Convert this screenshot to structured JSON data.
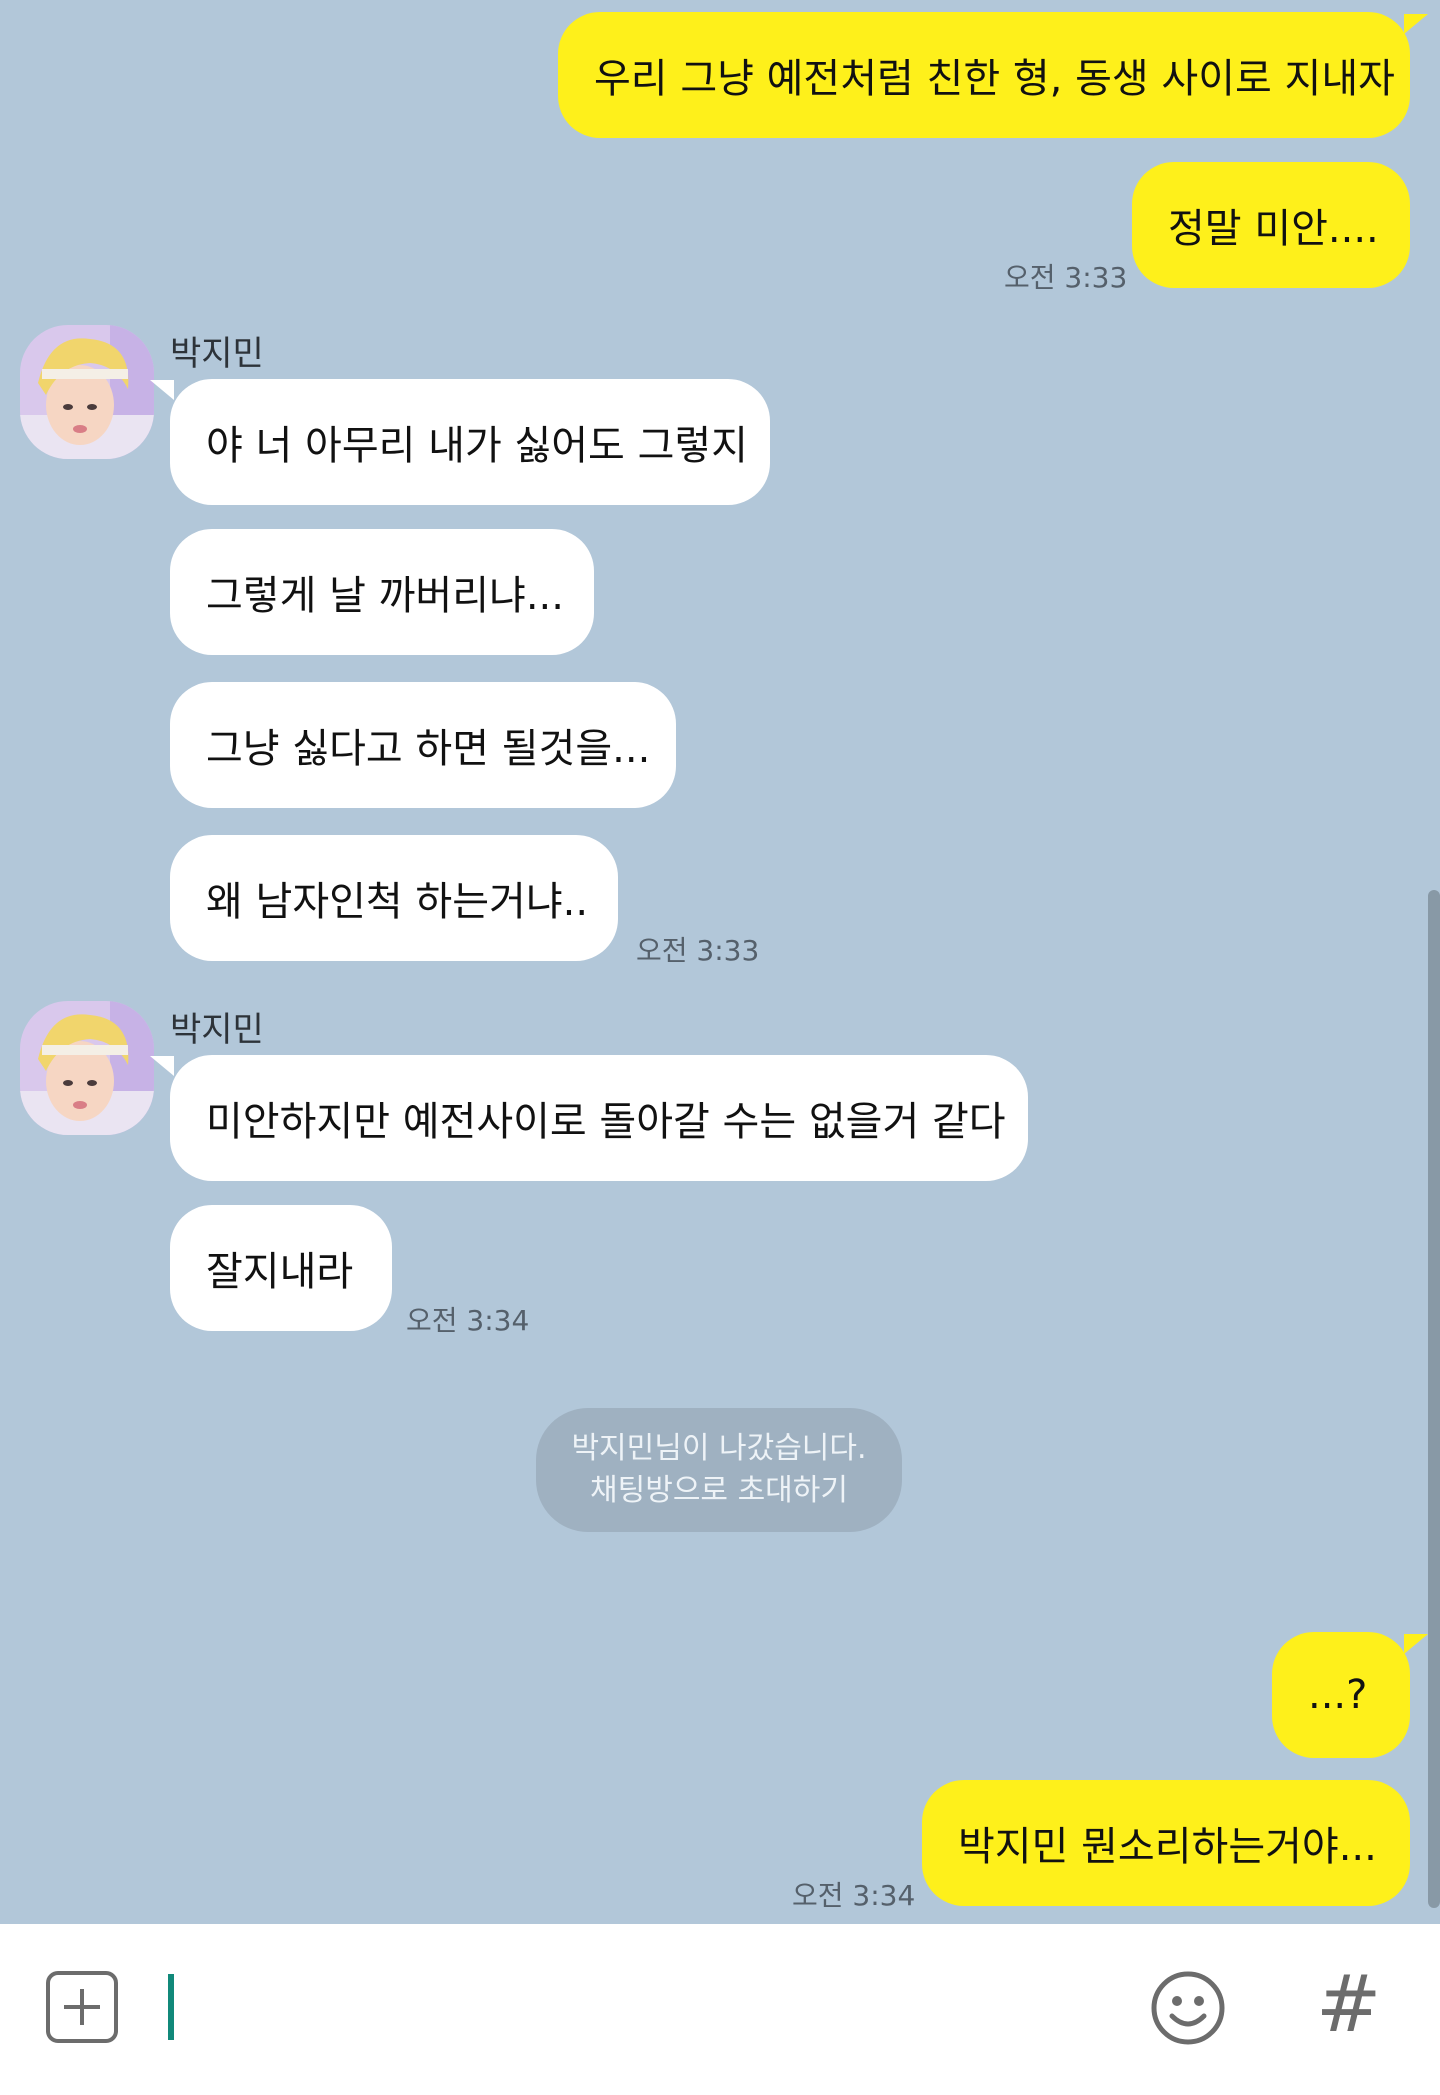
{
  "messages_sent_1": {
    "text1": "우리 그냥 예전처럼 친한 형, 동생 사이로 지내자",
    "text2": "정말 미안....",
    "time": "오전 3:33"
  },
  "messages_received_1": {
    "sender": "박지민",
    "text1": "야 너 아무리 내가 싫어도 그렇지",
    "text2": "그렇게 날 까버리냐...",
    "text3": "그냥 싫다고 하면 될것을...",
    "text4": "왜 남자인척 하는거냐..",
    "time": "오전 3:33"
  },
  "messages_received_2": {
    "sender": "박지민",
    "text1": "미안하지만 예전사이로 돌아갈 수는 없을거 같다",
    "text2": "잘지내라",
    "time": "오전 3:34"
  },
  "system_notice": {
    "line1": "박지민님이 나갔습니다.",
    "line2": "채팅방으로 초대하기"
  },
  "messages_sent_2": {
    "text1": "...?",
    "text2": "박지민 뭔소리하는거야...",
    "time": "오전 3:34"
  },
  "input_bar": {
    "attach_icon": "plus-square-icon",
    "emoji_icon": "smiley-icon",
    "hashtag_label": "#"
  },
  "colors": {
    "chat_background": "#b2c7d9",
    "sent_bubble": "#fef01b",
    "received_bubble": "#ffffff",
    "cursor": "#11897a"
  }
}
